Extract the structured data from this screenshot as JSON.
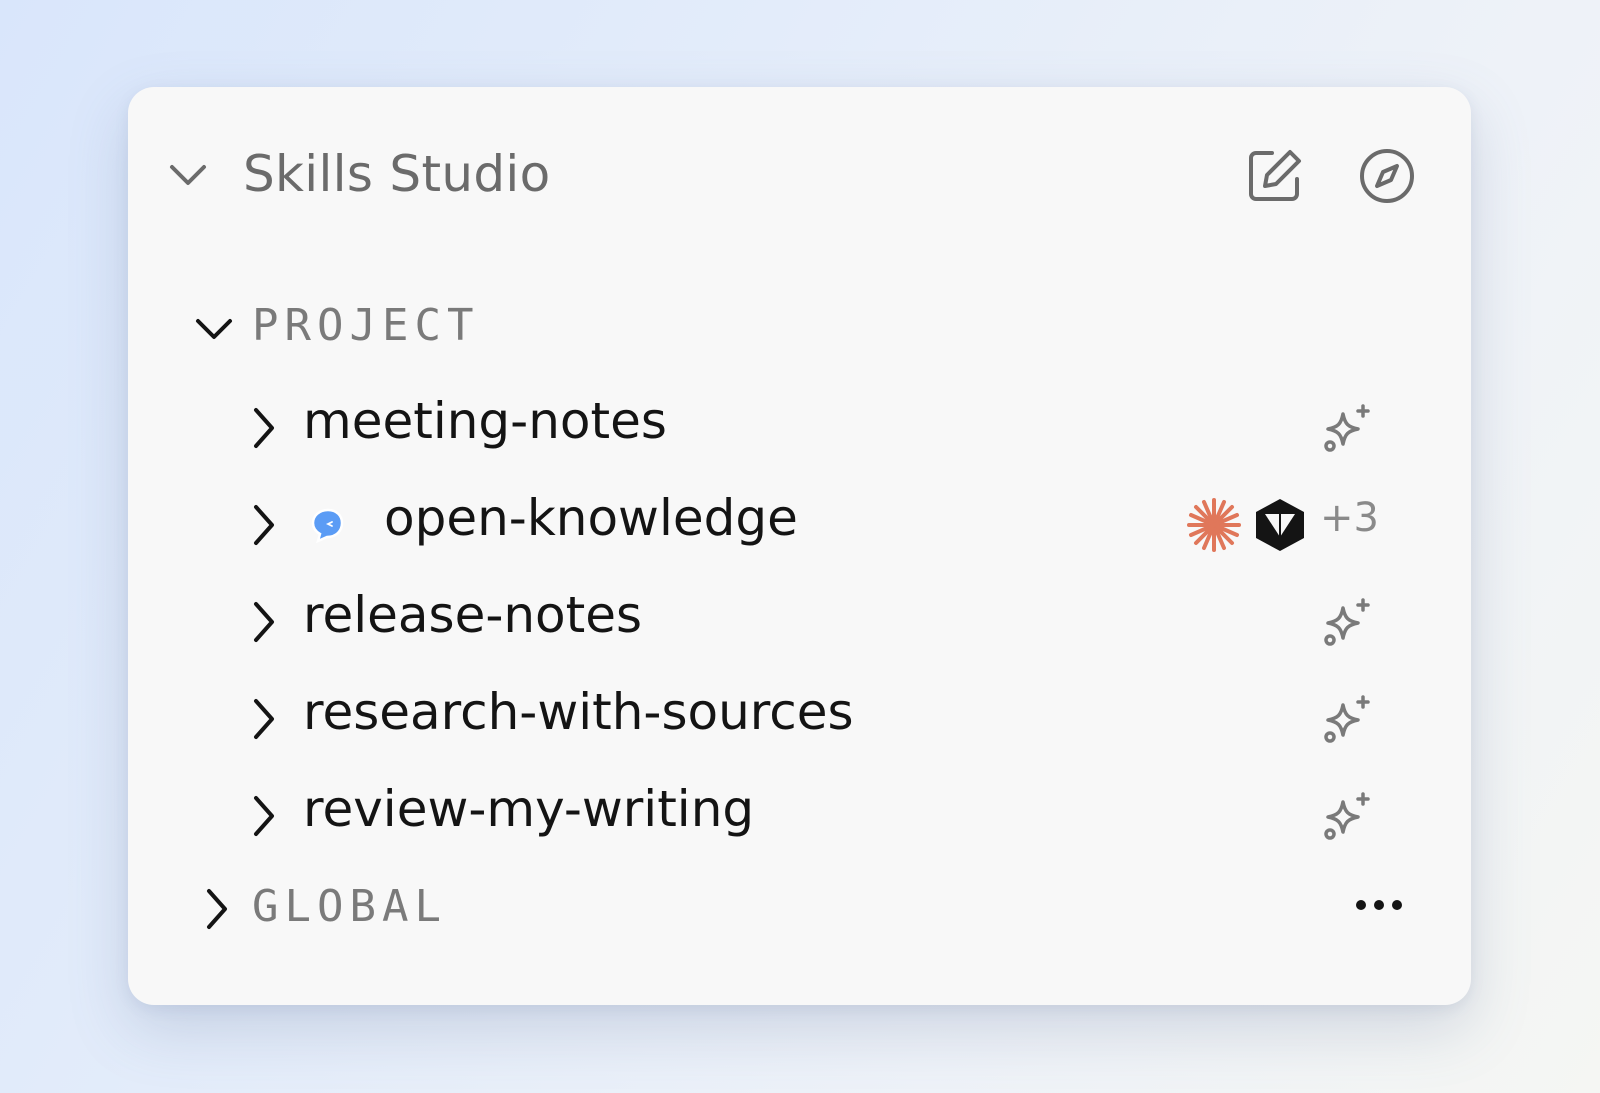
{
  "panel": {
    "title": "Skills Studio",
    "header_icons": [
      "edit-icon",
      "compass-icon"
    ]
  },
  "sections": {
    "project": {
      "label": "PROJECT",
      "expanded": true,
      "items": [
        {
          "label": "meeting-notes",
          "trailing_icon": "sparkle-icon"
        },
        {
          "label": "open-knowledge",
          "leading_icon": "chat-bubble-icon",
          "trailing_icons": [
            "starburst-icon",
            "cube-icon"
          ],
          "extra_count": "+3"
        },
        {
          "label": "release-notes",
          "trailing_icon": "sparkle-icon"
        },
        {
          "label": "research-with-sources",
          "trailing_icon": "sparkle-icon"
        },
        {
          "label": "review-my-writing",
          "trailing_icon": "sparkle-icon"
        }
      ]
    },
    "global": {
      "label": "GLOBAL",
      "expanded": false,
      "menu_icon": "more-icon"
    }
  },
  "colors": {
    "panel_bg": "#f8f8f8",
    "accent_orange": "#e0775a",
    "chat_bubble_blue": "#5b9cf5",
    "muted_text": "#7a7a7a",
    "primary_text": "#141414"
  }
}
